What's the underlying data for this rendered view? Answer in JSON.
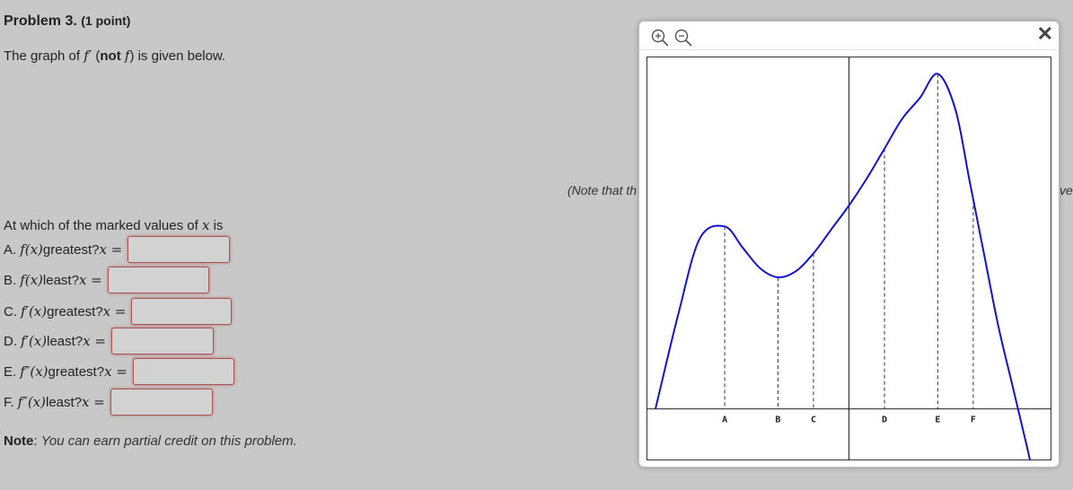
{
  "problem": {
    "title": "Problem 3.",
    "points": "(1 point)",
    "intro_prefix": "The graph of ",
    "intro_fprime": "f′",
    "intro_open": " (",
    "intro_not": "not",
    "intro_f": "f",
    "intro_close": ") is given below.",
    "note_truncated": "(Note that th",
    "note_truncated_right": "ve",
    "question_lead_text": "At which of the marked values of ",
    "question_lead_var": "x",
    "question_lead_suffix": " is",
    "questions": [
      {
        "letter": "A.",
        "func": "f(x)",
        "text": " greatest? ",
        "eq": "x =",
        "value": ""
      },
      {
        "letter": "B.",
        "func": "f(x)",
        "text": " least? ",
        "eq": "x =",
        "value": ""
      },
      {
        "letter": "C.",
        "func": "f′(x)",
        "text": " greatest? ",
        "eq": "x =",
        "value": ""
      },
      {
        "letter": "D.",
        "func": "f′(x)",
        "text": " least? ",
        "eq": "x =",
        "value": ""
      },
      {
        "letter": "E.",
        "func": "f″(x)",
        "text": " greatest? ",
        "eq": "x =",
        "value": ""
      },
      {
        "letter": "F.",
        "func": "f″(x)",
        "text": " least? ",
        "eq": "x =",
        "value": ""
      }
    ],
    "credit_label": "Note",
    "credit_colon": ": ",
    "credit_text": "You can earn partial credit on this problem."
  },
  "popup": {
    "zoom_in_icon": "zoom-in-icon",
    "zoom_out_icon": "zoom-out-icon",
    "close_glyph": "✕"
  },
  "chart_data": {
    "type": "line",
    "series": [
      {
        "color": "#1010e0",
        "x": [
          -5.45,
          -4.8,
          -4.2,
          -3.5,
          -3.0,
          -2.5,
          -2.0,
          -1.5,
          -1.0,
          -0.5,
          0.0,
          0.5,
          1.0,
          1.5,
          2.0,
          2.5,
          3.0,
          3.4,
          3.8,
          4.2,
          4.6,
          5.0,
          5.3
        ],
        "y": [
          0.0,
          1.6,
          2.85,
          3.05,
          2.7,
          2.35,
          2.2,
          2.3,
          2.6,
          3.0,
          3.4,
          3.85,
          4.35,
          4.85,
          5.2,
          5.6,
          5.0,
          3.8,
          2.6,
          1.4,
          0.4,
          -0.6,
          -1.4
        ]
      }
    ],
    "marked_points": [
      {
        "label": "A",
        "x": -3.5
      },
      {
        "label": "B",
        "x": -2.0
      },
      {
        "label": "C",
        "x": -1.0
      },
      {
        "label": "D",
        "x": 1.0
      },
      {
        "label": "E",
        "x": 2.5
      },
      {
        "label": "F",
        "x": 3.5
      }
    ],
    "xlim": [
      -5.5,
      5.5
    ],
    "ylim": [
      -0.5,
      5.8
    ],
    "grid": false,
    "axes_visible": true
  }
}
